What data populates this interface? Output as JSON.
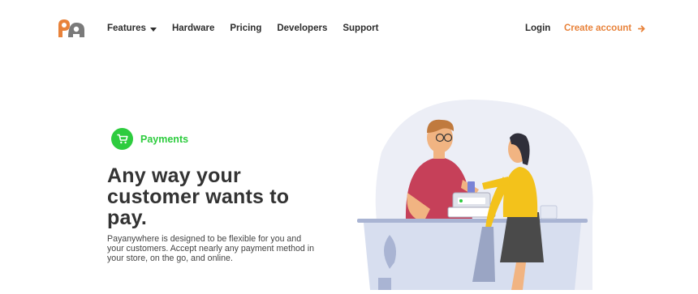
{
  "nav": {
    "items": [
      {
        "label": "Features",
        "has_dropdown": true
      },
      {
        "label": "Hardware"
      },
      {
        "label": "Pricing"
      },
      {
        "label": "Developers"
      },
      {
        "label": "Support"
      }
    ],
    "login_label": "Login",
    "create_account_label": "Create account",
    "create_account_icon": "arrow-right-icon"
  },
  "hero": {
    "badge_icon": "shopping-cart-icon",
    "badge_label": "Payments",
    "headline": "Any way your customer wants to pay.",
    "description": "Payanywhere is designed to be flexible for you and your customers. Accept nearly any payment method in your store, on the go, and online."
  },
  "colors": {
    "accent_orange": "#e8823a",
    "payments_green": "#2dcc3e",
    "text_dark": "#333333"
  }
}
